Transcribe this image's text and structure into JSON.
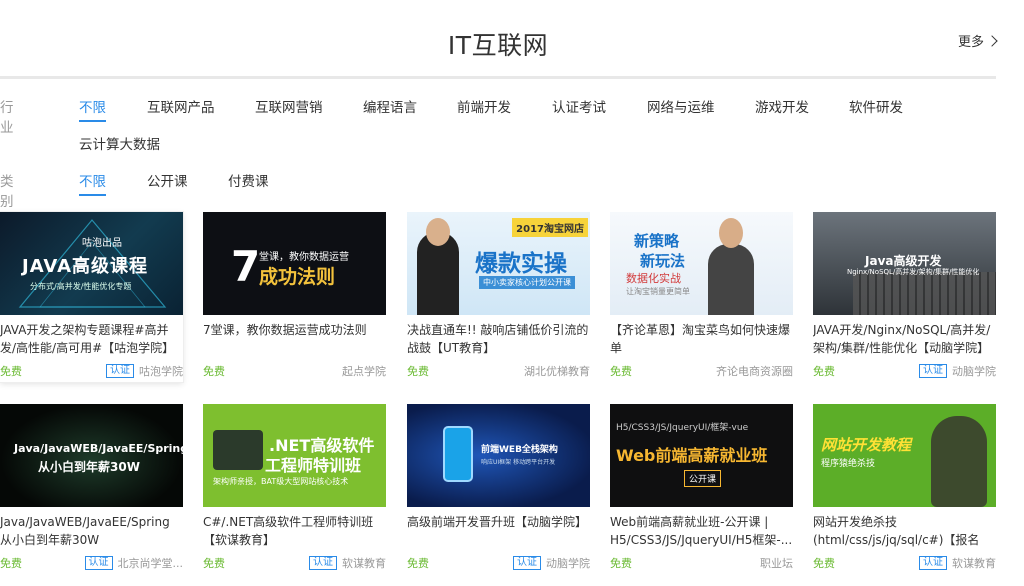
{
  "header": {
    "title": "IT互联网",
    "more_label": "更多"
  },
  "filters": {
    "industry": {
      "label": "行业",
      "options": [
        "不限",
        "互联网产品",
        "互联网营销",
        "编程语言",
        "前端开发",
        "认证考试",
        "网络与运维",
        "游戏开发",
        "软件研发",
        "云计算大数据"
      ],
      "selected": "不限"
    },
    "category": {
      "label": "类别",
      "options": [
        "不限",
        "公开课",
        "付费课"
      ],
      "selected": "不限"
    }
  },
  "courses": [
    {
      "title": "JAVA开发之架构专题课程#高并发/高性能/高可用#【咕泡学院】",
      "price": "免费",
      "certified": true,
      "badge": "认证",
      "provider": "咕泡学院",
      "thumb_main": "JAVA高级课程",
      "thumb_sub": "分布式/高并发/性能优化专题",
      "thumb_brand": "咕泡出品"
    },
    {
      "title": "7堂课，教你数据运营成功法则",
      "price": "免费",
      "certified": false,
      "provider": "起点学院",
      "thumb_main": "成功法则",
      "thumb_sub": "堂课，教你数据运营",
      "thumb_num": "7"
    },
    {
      "title": "决战直通车!! 敲响店铺低价引流的战鼓【UT教育】",
      "price": "免费",
      "certified": false,
      "provider": "湖北优梯教育",
      "thumb_main": "爆款实操",
      "thumb_sub": "中小卖家核心计划公开课",
      "thumb_tag": "2017淘宝网店"
    },
    {
      "title": "【齐论革恩】淘宝菜鸟如何快速爆单",
      "price": "免费",
      "certified": false,
      "provider": "齐论电商资源圈",
      "thumb_main": "新策略",
      "thumb_main2": "新玩法",
      "thumb_sub": "数据化实战",
      "thumb_sub2": "让淘宝销量更简单"
    },
    {
      "title": "JAVA开发/Nginx/NoSQL/高并发/架构/集群/性能优化【动脑学院】",
      "price": "免费",
      "certified": true,
      "badge": "认证",
      "provider": "动脑学院",
      "thumb_main": "Java高级开发",
      "thumb_sub": "Nginx/NoSQL/高并发/架构/集群/性能优化"
    },
    {
      "title": "Java/JavaWEB/JavaEE/Spring 从小白到年薪30W",
      "price": "免费",
      "certified": true,
      "badge": "认证",
      "provider": "北京尚学堂...",
      "thumb_main": "Java/JavaWEB/JavaEE/Spring",
      "thumb_sub": "从小白到年薪30W"
    },
    {
      "title": "C#/.NET高级软件工程师特训班【软谋教育】",
      "price": "免费",
      "certified": true,
      "badge": "认证",
      "provider": "软谋教育",
      "thumb_main": ".NET高级软件",
      "thumb_main2": "工程师特训班",
      "thumb_sub": "架构师亲授，BAT级大型网站核心技术"
    },
    {
      "title": "高级前端开发晋升班【动脑学院】",
      "price": "免费",
      "certified": true,
      "badge": "认证",
      "provider": "动脑学院",
      "thumb_main": "前端WEB全栈架构",
      "thumb_sub": "响应UI框架 移动跨平台开发"
    },
    {
      "title": "Web前端高薪就业班-公开课 | H5/CSS3/JS/JqueryUI/H5框架-...",
      "price": "免费",
      "certified": false,
      "provider": "职业坛",
      "thumb_main": "Web前端高薪就业班",
      "thumb_sub": "H5/CSS3/JS/JqueryUI/框架-vue",
      "thumb_tag": "公开课"
    },
    {
      "title": "网站开发绝杀技(html/css/js/jq/sql/c#)【报名课...",
      "price": "免费",
      "certified": true,
      "badge": "认证",
      "provider": "软谋教育",
      "thumb_main": "网站开发教程",
      "thumb_sub": "程序猿绝杀技"
    }
  ],
  "colors": {
    "accent": "#2a8be8",
    "free": "#6aba32",
    "muted": "#999999"
  }
}
